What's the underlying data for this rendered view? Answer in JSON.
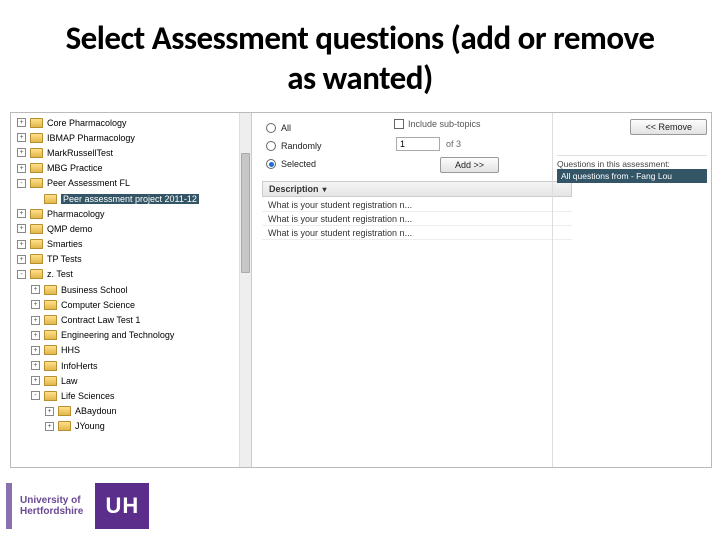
{
  "title": "Select Assessment questions (add or remove as wanted)",
  "tree": {
    "items": [
      {
        "label": "Core Pharmacology",
        "exp": "+",
        "sub": false
      },
      {
        "label": "IBMAP Pharmacology",
        "exp": "+",
        "sub": false
      },
      {
        "label": "MarkRussellTest",
        "exp": "+",
        "sub": false
      },
      {
        "label": "MBG Practice",
        "exp": "+",
        "sub": false
      },
      {
        "label": "Peer Assessment FL",
        "exp": "-",
        "sub": false
      },
      {
        "label": "Peer assessment project 2011-12",
        "exp": "",
        "sub": false,
        "sel": true
      },
      {
        "label": "Pharmacology",
        "exp": "+",
        "sub": false
      },
      {
        "label": "QMP demo",
        "exp": "+",
        "sub": false
      },
      {
        "label": "Smarties",
        "exp": "+",
        "sub": false
      },
      {
        "label": "TP Tests",
        "exp": "+",
        "sub": false
      },
      {
        "label": "z. Test",
        "exp": "-",
        "sub": false,
        "group": true
      },
      {
        "label": "Business School",
        "exp": "+",
        "sub": true
      },
      {
        "label": "Computer Science",
        "exp": "+",
        "sub": true
      },
      {
        "label": "Contract Law Test 1",
        "exp": "+",
        "sub": true
      },
      {
        "label": "Engineering and Technology",
        "exp": "+",
        "sub": true
      },
      {
        "label": "HHS",
        "exp": "+",
        "sub": true
      },
      {
        "label": "InfoHerts",
        "exp": "+",
        "sub": true
      },
      {
        "label": "Law",
        "exp": "+",
        "sub": true
      },
      {
        "label": "Life Sciences",
        "exp": "-",
        "sub": true
      },
      {
        "label": "ABaydoun",
        "exp": "+",
        "sub": true,
        "deep": true
      },
      {
        "label": "JYoung",
        "exp": "+",
        "sub": true,
        "deep": true
      }
    ]
  },
  "options": {
    "all": "All",
    "randomly": "Randomly",
    "selected": "Selected",
    "include": "Include sub-topics",
    "num_value": "1",
    "of": "of 3",
    "add": "Add >>",
    "remove": "<< Remove"
  },
  "desc_header": "Description",
  "questions": [
    "What is your student registration n...",
    "What is your student registration n...",
    "What is your student registration n..."
  ],
  "rightcol": {
    "hdr": "Questions in this assessment:",
    "row": "All questions from - Fang Lou"
  },
  "logo": {
    "line1": "University of",
    "line2": "Hertfordshire",
    "uh": "UH"
  }
}
